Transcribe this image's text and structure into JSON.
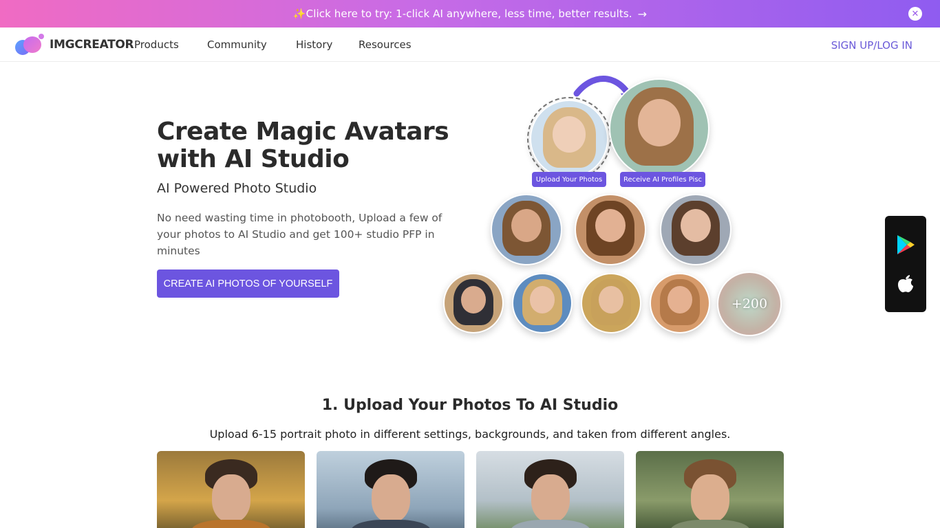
{
  "promo": {
    "text": "✨Click here to try: 1-click AI anywhere, less time, better results.",
    "arrow": "→",
    "close_icon": "close-icon"
  },
  "nav": {
    "logo_text": "IMGCREATOR",
    "links": [
      "Products",
      "Community",
      "History",
      "Resources"
    ],
    "signup": "SIGN UP/LOG IN"
  },
  "hero": {
    "title": "Create Magic Avatars with AI Studio",
    "subtitle": "AI Powered Photo Studio",
    "description": "No need wasting time in photobooth, Upload a few of your photos to AI Studio and get 100+ studio PFP in minutes",
    "cta": "CREATE AI PHOTOS OF YOURSELF"
  },
  "collage": {
    "upload_label": "Upload Your Photos",
    "receive_label": "Receive AI Profiles Pisc",
    "more_count": "+200"
  },
  "app_panel": {
    "icons": [
      "google-play-icon",
      "apple-icon"
    ]
  },
  "section": {
    "title": "1. Upload Your Photos To AI Studio",
    "subtitle": "Upload 6-15 portrait photo in different settings, backgrounds, and taken from different angles."
  },
  "colors": {
    "accent": "#6c55e0",
    "banner_start": "#f06bc3",
    "banner_end": "#8f5cf0"
  }
}
